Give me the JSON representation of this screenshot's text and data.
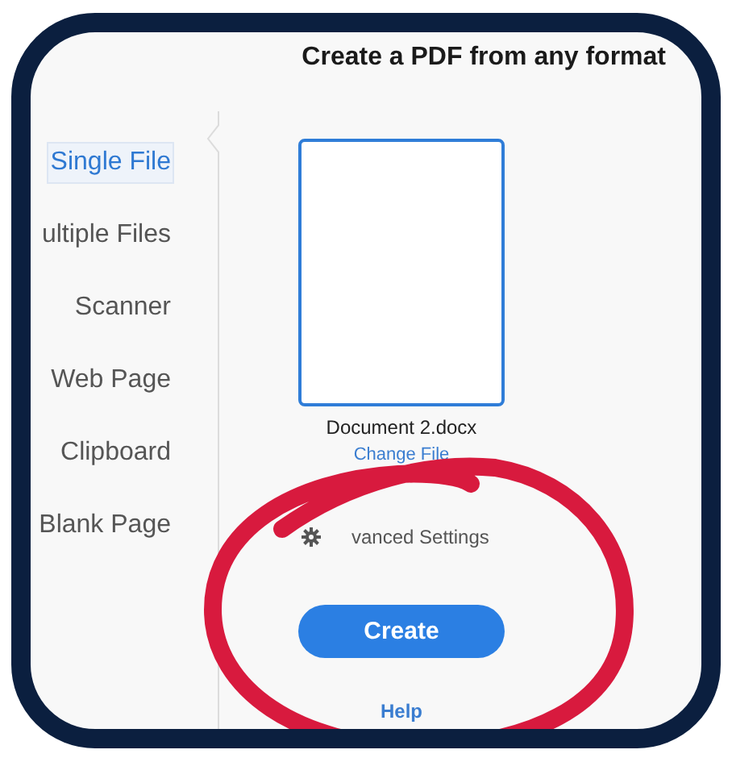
{
  "title": "Create a PDF from any format",
  "sidebar": {
    "items": [
      {
        "label": "Single File",
        "selected": true
      },
      {
        "label": "ultiple Files",
        "selected": false
      },
      {
        "label": "Scanner",
        "selected": false
      },
      {
        "label": "Web Page",
        "selected": false
      },
      {
        "label": "Clipboard",
        "selected": false
      },
      {
        "label": "Blank Page",
        "selected": false
      }
    ]
  },
  "file": {
    "name": "Document 2.docx",
    "change_link": "Change File"
  },
  "advanced_settings": "vanced Settings",
  "create_button": "Create",
  "help_link": "Help"
}
